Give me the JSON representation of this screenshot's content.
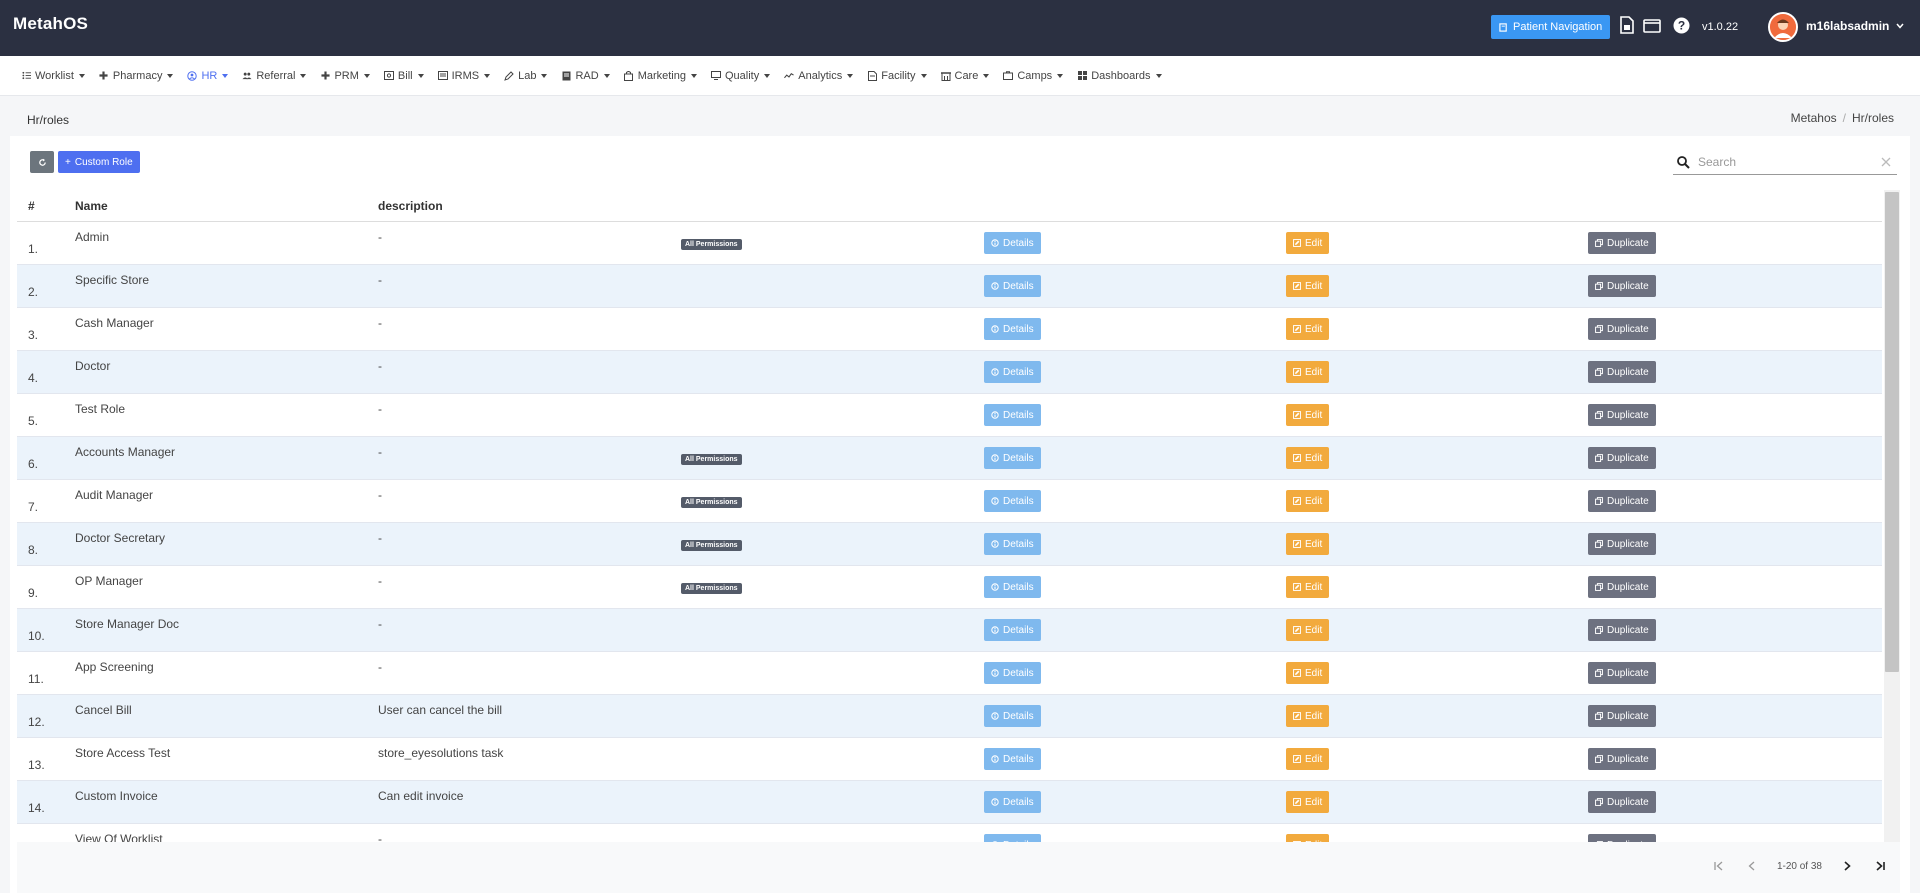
{
  "app": {
    "brand": "MetahOS",
    "patient_nav_label": "Patient Navigation",
    "version": "v1.0.22",
    "username": "m16labsadmin"
  },
  "nav": [
    {
      "label": "Worklist",
      "icon": "list-icon"
    },
    {
      "label": "Pharmacy",
      "icon": "plus-icon"
    },
    {
      "label": "HR",
      "icon": "user-circle-icon",
      "active": true
    },
    {
      "label": "Referral",
      "icon": "users-icon"
    },
    {
      "label": "PRM",
      "icon": "plus-icon"
    },
    {
      "label": "Bill",
      "icon": "bill-icon"
    },
    {
      "label": "IRMS",
      "icon": "id-card-icon"
    },
    {
      "label": "Lab",
      "icon": "pen-icon"
    },
    {
      "label": "RAD",
      "icon": "doc-icon"
    },
    {
      "label": "Marketing",
      "icon": "bag-icon"
    },
    {
      "label": "Quality",
      "icon": "monitor-icon"
    },
    {
      "label": "Analytics",
      "icon": "chart-line-icon"
    },
    {
      "label": "Facility",
      "icon": "file-icon"
    },
    {
      "label": "Care",
      "icon": "building-icon"
    },
    {
      "label": "Camps",
      "icon": "tent-icon"
    },
    {
      "label": "Dashboards",
      "icon": "grid-icon"
    }
  ],
  "page": {
    "title": "Hr/roles",
    "breadcrumb": [
      "Metahos",
      "Hr/roles"
    ]
  },
  "toolbar": {
    "custom_role_label": "Custom Role",
    "search_placeholder": "Search"
  },
  "table": {
    "headers": {
      "num": "#",
      "name": "Name",
      "description": "description"
    },
    "badge_label": "All Permissions",
    "details_label": "Details",
    "edit_label": "Edit",
    "duplicate_label": "Duplicate",
    "rows": [
      {
        "num": "1.",
        "name": "Admin",
        "description": "-",
        "all_permissions": true
      },
      {
        "num": "2.",
        "name": "Specific Store",
        "description": "-",
        "all_permissions": false
      },
      {
        "num": "3.",
        "name": "Cash Manager",
        "description": "-",
        "all_permissions": false
      },
      {
        "num": "4.",
        "name": "Doctor",
        "description": "-",
        "all_permissions": false
      },
      {
        "num": "5.",
        "name": "Test Role",
        "description": "-",
        "all_permissions": false
      },
      {
        "num": "6.",
        "name": "Accounts Manager",
        "description": "-",
        "all_permissions": true
      },
      {
        "num": "7.",
        "name": "Audit Manager",
        "description": "-",
        "all_permissions": true
      },
      {
        "num": "8.",
        "name": "Doctor Secretary",
        "description": "-",
        "all_permissions": true
      },
      {
        "num": "9.",
        "name": "OP Manager",
        "description": "-",
        "all_permissions": true
      },
      {
        "num": "10.",
        "name": "Store Manager Doc",
        "description": "-",
        "all_permissions": false
      },
      {
        "num": "11.",
        "name": "App Screening",
        "description": "-",
        "all_permissions": false
      },
      {
        "num": "12.",
        "name": "Cancel Bill",
        "description": "User can cancel the bill",
        "all_permissions": false
      },
      {
        "num": "13.",
        "name": "Store Access Test",
        "description": "store_eyesolutions task",
        "all_permissions": false
      },
      {
        "num": "14.",
        "name": "Custom Invoice",
        "description": "Can edit invoice",
        "all_permissions": false
      },
      {
        "num": "",
        "name": "View Of Worklist",
        "description": "-",
        "all_permissions": false
      }
    ]
  },
  "pagination": {
    "range": "1-20 of 38"
  },
  "colors": {
    "topbar": "#2b3041",
    "accent": "#4e6ff0",
    "details": "#7fb9ee",
    "edit": "#f2aa3d",
    "duplicate": "#6d7180"
  }
}
